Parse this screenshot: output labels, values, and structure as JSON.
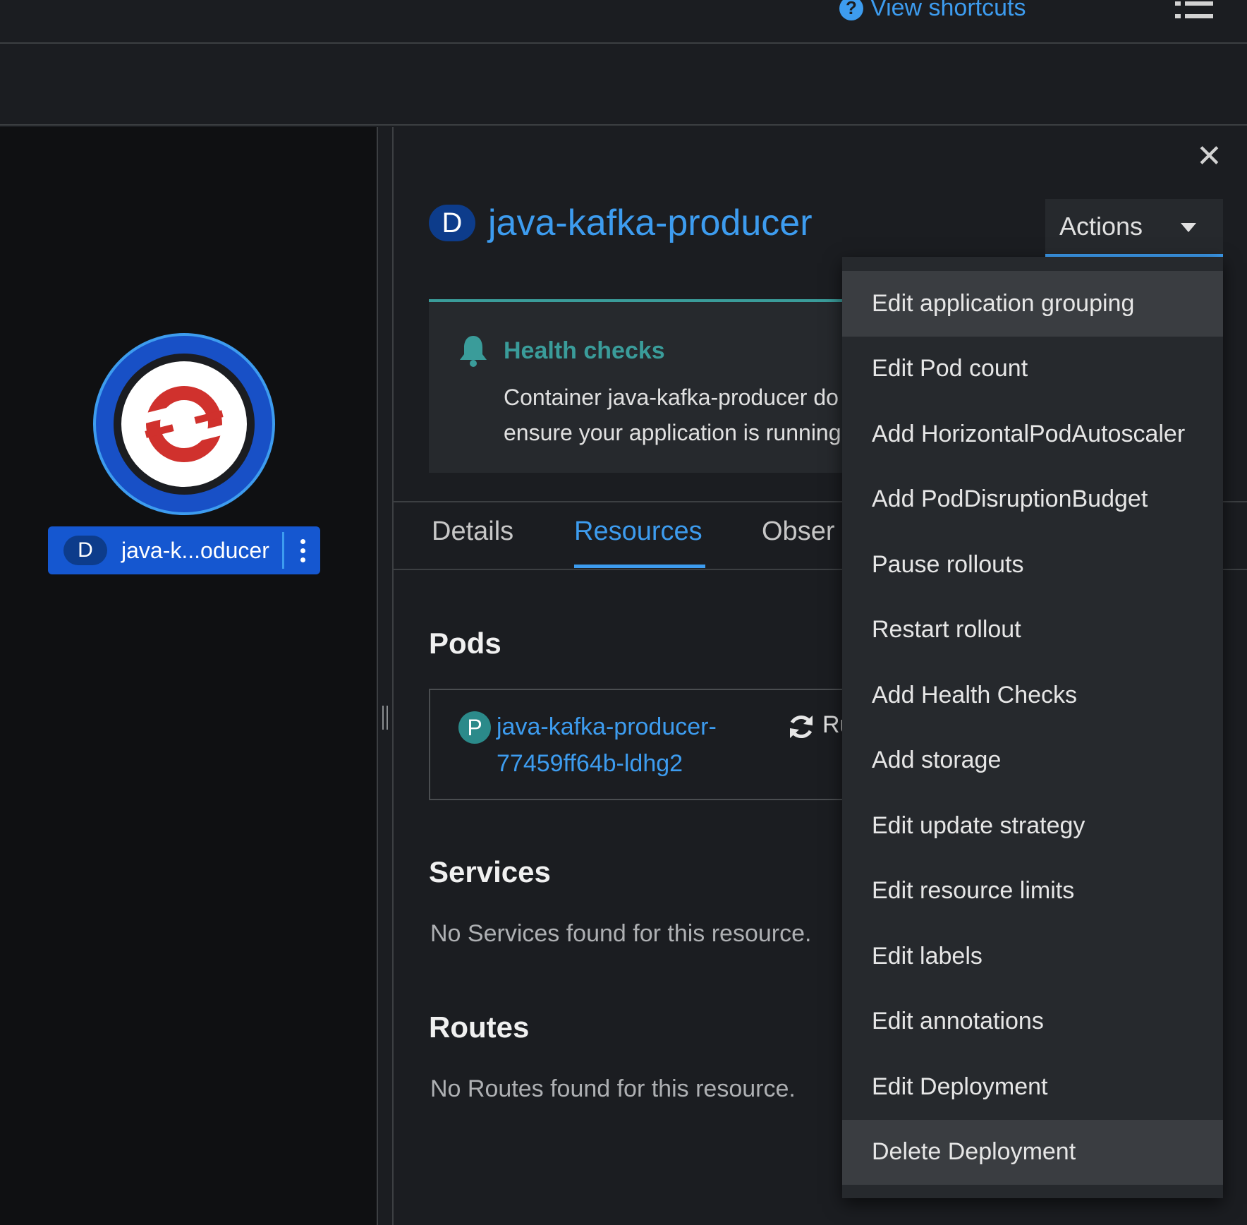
{
  "masthead": {
    "shortcuts_label": "View shortcuts"
  },
  "topology": {
    "node_badge": "D",
    "node_name": "java-k...oducer"
  },
  "panel": {
    "badge": "D",
    "title": "java-kafka-producer",
    "actions_label": "Actions",
    "alert": {
      "title": "Health checks",
      "body_line1": "Container java-kafka-producer do",
      "body_line2": "ensure your application is running"
    },
    "tabs": [
      {
        "label": "Details"
      },
      {
        "label": "Resources"
      },
      {
        "label": "Obser"
      }
    ],
    "pods": {
      "title": "Pods",
      "pod_badge": "P",
      "pod_name_line1": "java-kafka-producer-",
      "pod_name_line2": "77459ff64b-ldhg2",
      "pod_status": "Ru"
    },
    "services": {
      "title": "Services",
      "empty": "No Services found for this resource."
    },
    "routes": {
      "title": "Routes",
      "empty": "No Routes found for this resource."
    }
  },
  "actions_menu": {
    "items": [
      {
        "label": "Edit application grouping"
      },
      {
        "label": "Edit Pod count"
      },
      {
        "label": "Add HorizontalPodAutoscaler"
      },
      {
        "label": "Add PodDisruptionBudget"
      },
      {
        "label": "Pause rollouts"
      },
      {
        "label": "Restart rollout"
      },
      {
        "label": "Add Health Checks"
      },
      {
        "label": "Add storage"
      },
      {
        "label": "Edit update strategy"
      },
      {
        "label": "Edit resource limits"
      },
      {
        "label": "Edit labels"
      },
      {
        "label": "Edit annotations"
      },
      {
        "label": "Edit Deployment"
      },
      {
        "label": "Delete Deployment"
      }
    ]
  },
  "colors": {
    "link_blue": "#3d9cef",
    "alert_teal": "#3a9c9a",
    "node_blue": "#1557d0",
    "openshift_red": "#d0312d"
  }
}
